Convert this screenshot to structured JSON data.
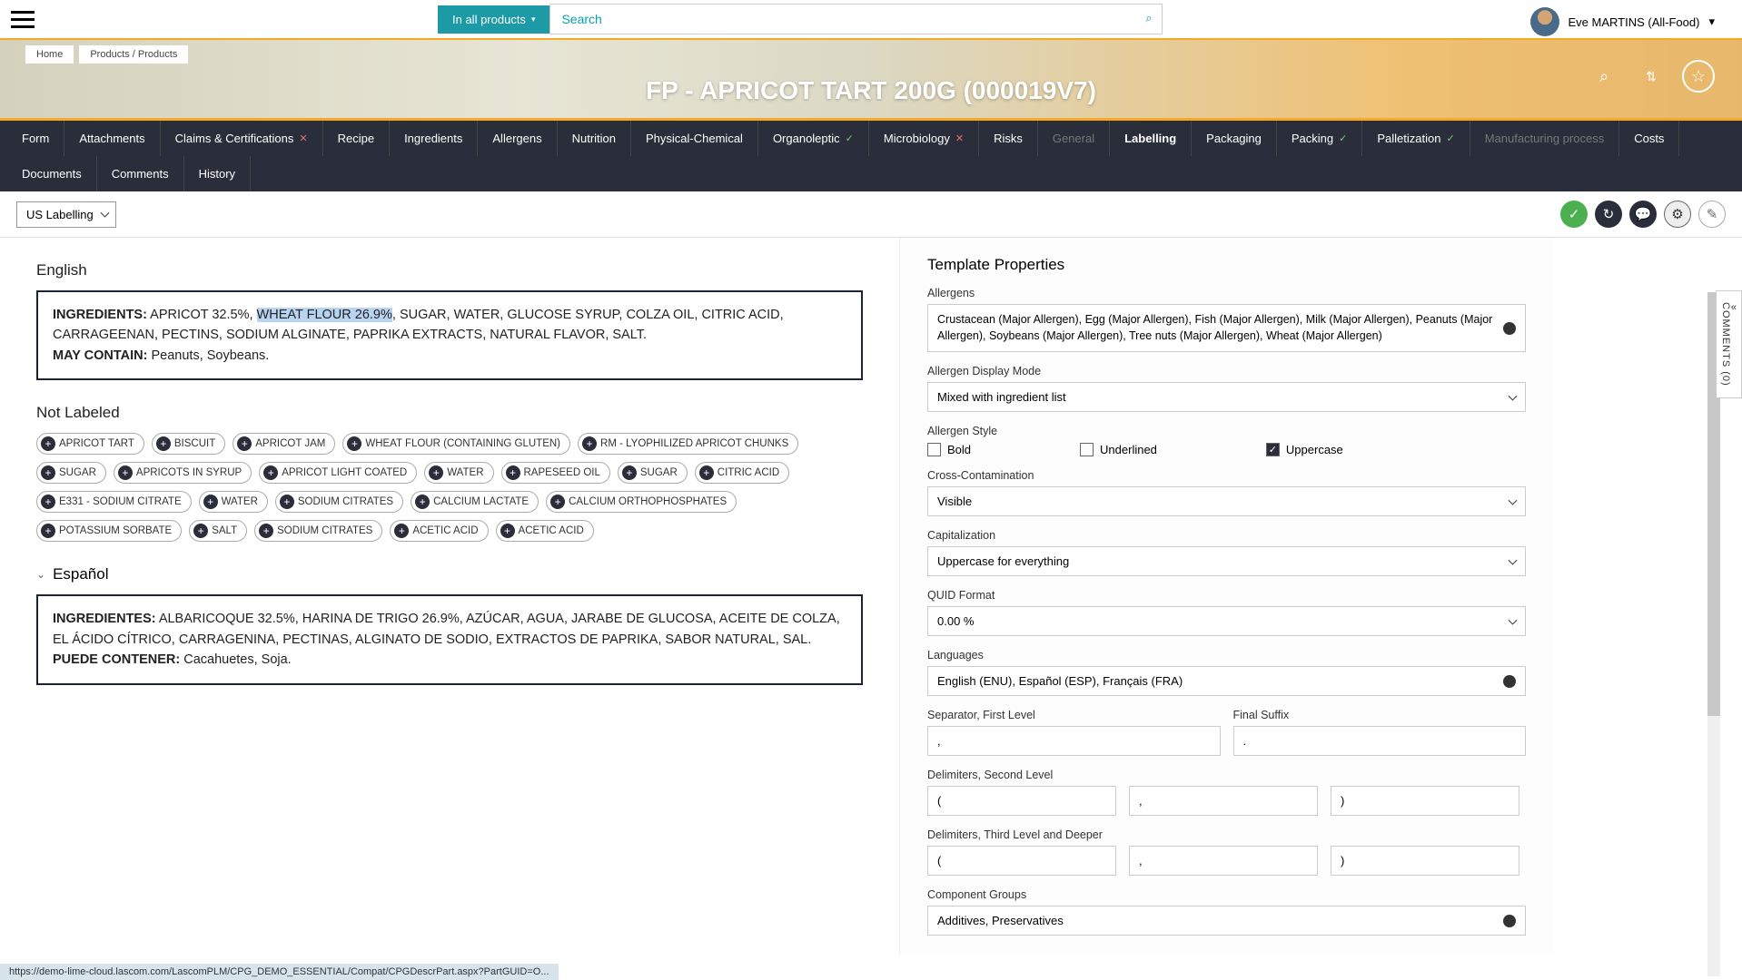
{
  "topbar": {
    "search_category": "In all products",
    "search_placeholder": "Search",
    "user_name": "Eve MARTINS (All-Food)"
  },
  "breadcrumb": {
    "home": "Home",
    "path": "Products / Products"
  },
  "hero": {
    "title": "FP - APRICOT TART 200G (000019V7)"
  },
  "tabs": {
    "form": "Form",
    "attachments": "Attachments",
    "claims": "Claims & Certifications",
    "recipe": "Recipe",
    "ingredients": "Ingredients",
    "allergens": "Allergens",
    "nutrition": "Nutrition",
    "physical": "Physical-Chemical",
    "organoleptic": "Organoleptic",
    "microbiology": "Microbiology",
    "risks": "Risks",
    "general": "General",
    "labelling": "Labelling",
    "packaging": "Packaging",
    "packing": "Packing",
    "palletization": "Palletization",
    "manufacturing": "Manufacturing process",
    "costs": "Costs",
    "documents": "Documents",
    "comments": "Comments",
    "history": "History"
  },
  "subbar": {
    "labelling_preset": "US Labelling"
  },
  "english": {
    "title": "English",
    "ing_label": "INGREDIENTS:",
    "ing_pre": " APRICOT 32.5%, ",
    "ing_hl": "WHEAT FLOUR 26.9%",
    "ing_post": ", SUGAR, WATER, GLUCOSE SYRUP, COLZA OIL, CITRIC ACID, CARRAGEENAN, PECTINS, SODIUM ALGINATE, PAPRIKA EXTRACTS, NATURAL FLAVOR, SALT.",
    "may_label": "MAY CONTAIN:",
    "may_text": " Peanuts, Soybeans."
  },
  "not_labeled_title": "Not Labeled",
  "chips": [
    "APRICOT TART",
    "BISCUIT",
    "APRICOT JAM",
    "WHEAT FLOUR (CONTAINING GLUTEN)",
    "RM - LYOPHILIZED APRICOT CHUNKS",
    "SUGAR",
    "APRICOTS IN SYRUP",
    "APRICOT LIGHT COATED",
    "WATER",
    "RAPESEED OIL",
    "SUGAR",
    "CITRIC ACID",
    "E331 - SODIUM CITRATE",
    "WATER",
    "SODIUM CITRATES",
    "CALCIUM LACTATE",
    "CALCIUM ORTHOPHOSPHATES",
    "POTASSIUM SORBATE",
    "SALT",
    "SODIUM CITRATES",
    "ACETIC ACID",
    "ACETIC ACID"
  ],
  "espanol": {
    "title": "Español",
    "ing_label": "INGREDIENTES:",
    "ing_text": " ALBARICOQUE 32.5%, HARINA DE TRIGO 26.9%, AZÚCAR, AGUA, JARABE DE GLUCOSA, ACEITE DE COLZA, EL ÁCIDO CÍTRICO, CARRAGENINA, PECTINAS, ALGINATO DE SODIO, EXTRACTOS DE PAPRIKA, SABOR NATURAL, SAL.",
    "may_label": "PUEDE CONTENER:",
    "may_text": " Cacahuetes, Soja."
  },
  "props": {
    "title": "Template Properties",
    "allergens_label": "Allergens",
    "allergens_value": "Crustacean (Major Allergen), Egg (Major Allergen), Fish (Major Allergen), Milk (Major Allergen), Peanuts (Major Allergen), Soybeans (Major Allergen), Tree nuts (Major Allergen), Wheat (Major Allergen)",
    "display_mode_label": "Allergen Display Mode",
    "display_mode_value": "Mixed with ingredient list",
    "style_label": "Allergen Style",
    "bold": "Bold",
    "underlined": "Underlined",
    "uppercase": "Uppercase",
    "cross_label": "Cross-Contamination",
    "cross_value": "Visible",
    "cap_label": "Capitalization",
    "cap_value": "Uppercase for everything",
    "quid_label": "QUID Format",
    "quid_value": "0.00 %",
    "lang_label": "Languages",
    "lang_value": "English (ENU), Español (ESP), Français (FRA)",
    "sep_label": "Separator, First Level",
    "sep_value": ",",
    "suffix_label": "Final Suffix",
    "suffix_value": ".",
    "del2_label": "Delimiters, Second Level",
    "del2_a": "(",
    "del2_b": ",",
    "del2_c": ")",
    "del3_label": "Delimiters, Third Level and Deeper",
    "del3_a": "(",
    "del3_b": ",",
    "del3_c": ")",
    "comp_label": "Component Groups",
    "comp_value": "Additives, Preservatives"
  },
  "comments_tab": "COMMENTS (0)",
  "statusbar": "https://demo-lime-cloud.lascom.com/LascomPLM/CPG_DEMO_ESSENTIAL/Compat/CPGDescrPart.aspx?PartGUID=O..."
}
